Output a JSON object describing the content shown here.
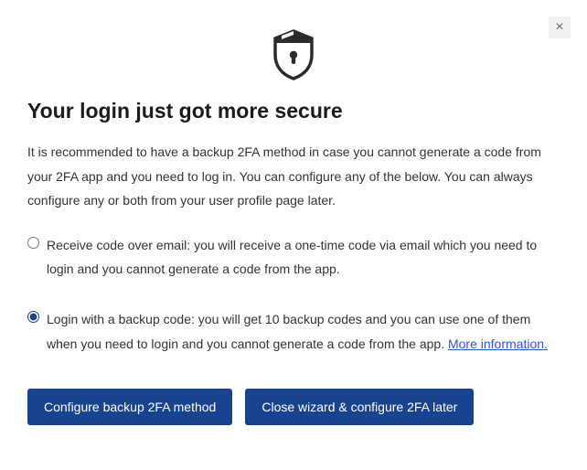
{
  "close_label": "×",
  "heading": "Your login just got more secure",
  "description": "It is recommended to have a backup 2FA method in case you cannot generate a code from your 2FA app and you need to log in. You can configure any of the below. You can always configure any or both from your user profile page later.",
  "options": {
    "email": "Receive code over email: you will receive a one-time code via email which you need to login and you cannot generate a code from the app.",
    "backup": "Login with a backup code: you will get 10 backup codes and you can use one of them when you need to login and you cannot generate a code from the app. ",
    "more_info": "More information."
  },
  "buttons": {
    "configure": "Configure backup 2FA method",
    "close": "Close wizard & configure 2FA later"
  }
}
